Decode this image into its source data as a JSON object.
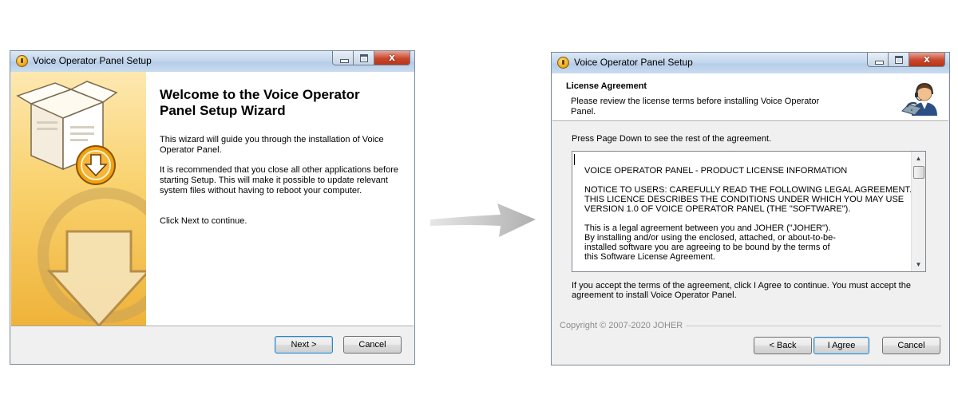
{
  "left_window": {
    "title": "Voice Operator Panel Setup",
    "close_glyph": "x",
    "heading": "Welcome to the Voice Operator Panel Setup Wizard",
    "paragraphs": [
      "This wizard will guide you through the installation of Voice Operator Panel.",
      "It is recommended that you close all other applications before starting Setup. This will make it possible to update relevant system files without having to reboot your computer.",
      "Click Next to continue."
    ],
    "buttons": {
      "next": "Next >",
      "cancel": "Cancel"
    },
    "side_icon": "installer-box-icon"
  },
  "right_window": {
    "title": "Voice Operator Panel Setup",
    "close_glyph": "x",
    "header_title": "License Agreement",
    "header_subtitle": "Please review the license terms before installing Voice Operator Panel.",
    "header_icon": "operator-headset-icon",
    "instruction": "Press Page Down to see the rest of the agreement.",
    "license_lines": [
      "VOICE OPERATOR PANEL - PRODUCT LICENSE INFORMATION",
      "",
      "NOTICE TO USERS: CAREFULLY READ THE FOLLOWING LEGAL AGREEMENT.",
      "THIS LICENCE DESCRIBES THE CONDITIONS UNDER WHICH YOU MAY USE",
      "VERSION 1.0 OF VOICE OPERATOR PANEL (THE \"SOFTWARE\").",
      "",
      "This is a legal agreement between you and JOHER (\"JOHER\").",
      "By installing and/or using the enclosed, attached, or about-to-be-",
      "installed software you are agreeing to be bound by the terms of",
      "this Software License Agreement."
    ],
    "accept_text": "If you accept the terms of the agreement, click I Agree to continue. You must accept the agreement to install Voice Operator Panel.",
    "copyright": "Copyright © 2007-2020 JOHER",
    "buttons": {
      "back": "< Back",
      "agree": "I Agree",
      "cancel": "Cancel"
    },
    "scroll_up_glyph": "▲",
    "scroll_down_glyph": "▼"
  },
  "transition_arrow": "arrow-right-icon",
  "colors": {
    "sidebar_top": "#fde8b0",
    "sidebar_bottom": "#efb33a",
    "title_bar": "#c4d7ed",
    "close_button": "#c9462c"
  }
}
